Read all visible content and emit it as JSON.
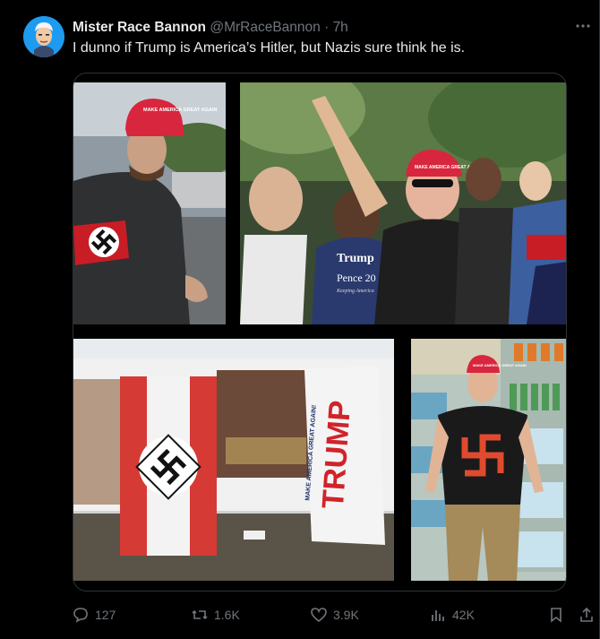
{
  "tweet": {
    "name": "Mister Race Bannon",
    "handle": "@MrRaceBannon",
    "separator": "·",
    "time": "7h",
    "text": "I dunno if Trump is America’s Hitler, but Nazis sure think he is."
  },
  "media": {
    "photos": [
      {
        "cap": "MAKE AMERICA GREAT AGAIN"
      },
      {
        "cap": "MAKE AMERICA GREAT AGAIN",
        "shirt": "Trump",
        "sign": "Pence 20",
        "sub": "Keeping America"
      },
      {
        "banner_sub": "MAKE AMERICA GREAT AGAIN!",
        "banner_main": "TRUMP"
      },
      {
        "cap": "MAKE AMERICA GREAT AGAIN"
      }
    ]
  },
  "actions": {
    "reply": "127",
    "repost": "1.6K",
    "like": "3.9K",
    "views": "42K"
  },
  "icons": {
    "more": "more-icon",
    "reply": "reply-icon",
    "repost": "repost-icon",
    "like": "heart-icon",
    "views": "views-icon",
    "bookmark": "bookmark-icon",
    "share": "share-icon"
  },
  "colors": {
    "background": "#000000",
    "text": "#e7e9ea",
    "secondary": "#71767b",
    "cap_red": "#d7263d"
  }
}
